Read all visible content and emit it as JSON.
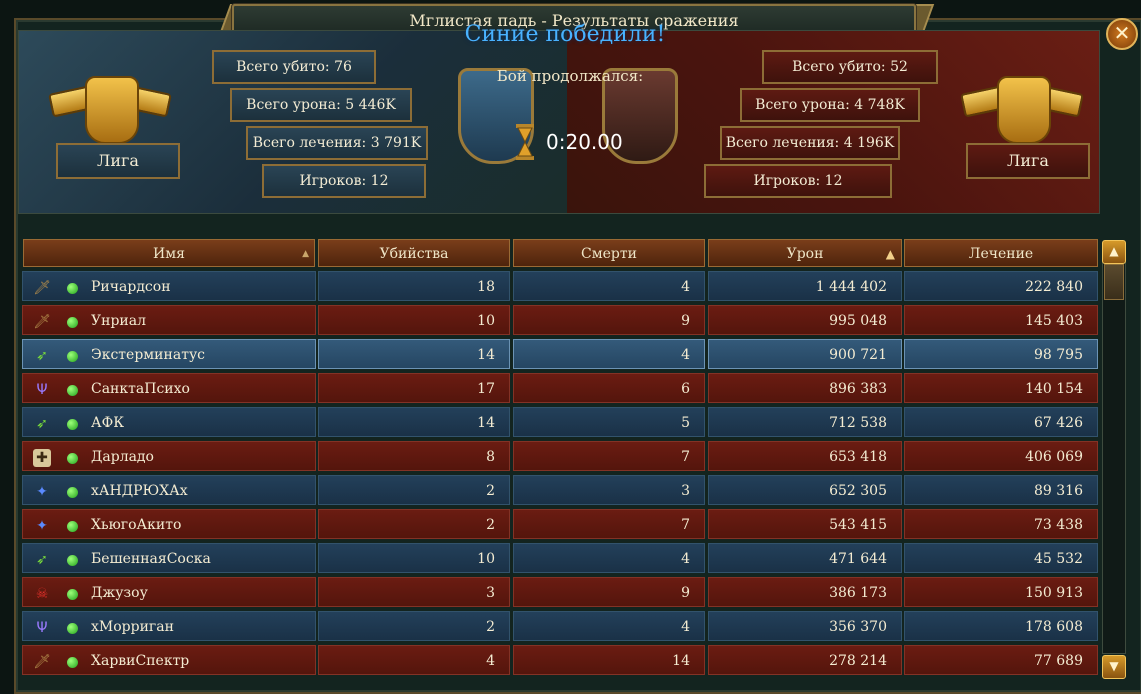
{
  "window": {
    "title": "Мглистая падь - Результаты сражения",
    "close_label": "✕"
  },
  "result": {
    "victory_text": "Синие победили!",
    "duration_label": "Бой продолжался:",
    "duration": "0:20.00"
  },
  "blue_team": {
    "league": "Лига",
    "total_kills": "Всего убито: 76",
    "total_damage": "Всего урона: 5 446K",
    "total_healing": "Всего лечения: 3 791K",
    "players": "Игроков: 12"
  },
  "red_team": {
    "league": "Лига",
    "total_kills": "Всего убито: 52",
    "total_damage": "Всего урона: 4 748K",
    "total_healing": "Всего лечения: 4 196K",
    "players": "Игроков: 12"
  },
  "table": {
    "headers": {
      "name": "Имя",
      "kills": "Убийства",
      "deaths": "Смерти",
      "damage": "Урон",
      "healing": "Лечение"
    },
    "rows": [
      {
        "team": "blue",
        "icon": "sword-icon",
        "name": "Ричардсон",
        "kills": "18",
        "deaths": "4",
        "damage": "1 444 402",
        "healing": "222 840"
      },
      {
        "team": "red",
        "icon": "sword-icon",
        "name": "Унриал",
        "kills": "10",
        "deaths": "9",
        "damage": "995 048",
        "healing": "145 403"
      },
      {
        "team": "blue",
        "icon": "arrow-icon",
        "name": "Экстерминатус",
        "kills": "14",
        "deaths": "4",
        "damage": "900 721",
        "healing": "98 795",
        "selected": true
      },
      {
        "team": "red",
        "icon": "claw-icon",
        "name": "СанктаПсихо",
        "kills": "17",
        "deaths": "6",
        "damage": "896 383",
        "healing": "140 154"
      },
      {
        "team": "blue",
        "icon": "arrow-icon",
        "name": "АФК",
        "kills": "14",
        "deaths": "5",
        "damage": "712 538",
        "healing": "67 426"
      },
      {
        "team": "red",
        "icon": "shield-cross-icon",
        "name": "Дарладо",
        "kills": "8",
        "deaths": "7",
        "damage": "653 418",
        "healing": "406 069"
      },
      {
        "team": "blue",
        "icon": "staff-icon",
        "name": "хАНДРЮХАх",
        "kills": "2",
        "deaths": "3",
        "damage": "652 305",
        "healing": "89 316"
      },
      {
        "team": "red",
        "icon": "staff-icon",
        "name": "ХьюгоАкито",
        "kills": "2",
        "deaths": "7",
        "damage": "543 415",
        "healing": "73 438"
      },
      {
        "team": "blue",
        "icon": "arrow-icon",
        "name": "БешеннаяСоска",
        "kills": "10",
        "deaths": "4",
        "damage": "471 644",
        "healing": "45 532"
      },
      {
        "team": "red",
        "icon": "skull-icon",
        "name": "Джузоу",
        "kills": "3",
        "deaths": "9",
        "damage": "386 173",
        "healing": "150 913"
      },
      {
        "team": "blue",
        "icon": "claw-icon",
        "name": "хМорриган",
        "kills": "2",
        "deaths": "4",
        "damage": "356 370",
        "healing": "178 608"
      },
      {
        "team": "red",
        "icon": "sword-icon",
        "name": "ХарвиСпектр",
        "kills": "4",
        "deaths": "14",
        "damage": "278 214",
        "healing": "77 689"
      }
    ]
  },
  "colors": {
    "blue_row": "#1f3a52",
    "red_row": "#621a10",
    "online": "#3fd02a",
    "victory_text": "#49b2ff"
  }
}
